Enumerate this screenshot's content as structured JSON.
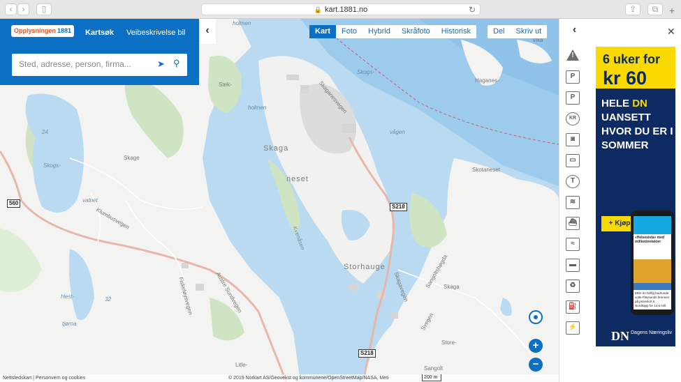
{
  "browser": {
    "url": "kart.1881.no",
    "back_icon": "chevron-left-icon",
    "forward_icon": "chevron-right-icon"
  },
  "header": {
    "logo_text": "Opplysningen",
    "logo_number": "1881",
    "tabs": [
      "Kartsøk",
      "Veibeskrivelse bil"
    ],
    "search_placeholder": "Sted, adresse, person, firma..."
  },
  "map_types": [
    "Kart",
    "Foto",
    "Hybrid",
    "Skråfoto",
    "Historisk"
  ],
  "map_actions": [
    "Del",
    "Skriv ut"
  ],
  "map_labels": {
    "water": [
      "Skogs-",
      "vågen",
      "Skogs-",
      "vatnet",
      "Hest-",
      "tjørna",
      "32",
      "24"
    ],
    "places": [
      "holmen",
      "Stek-",
      "holmen",
      "Skaga",
      "neset",
      "Storhauge",
      "Skotaneset",
      "Skaga",
      "Store-",
      "Sangolt",
      "Litle-",
      "Haganes-",
      "Vika",
      "Kvenåsen",
      "Skage"
    ],
    "roads": [
      "Skaganesvegen",
      "Austre Sundvegen",
      "Fiskeløysvegen",
      "Klumbusvegen",
      "Sangoltshøgda",
      "Skagavegen",
      "Svegen"
    ],
    "shields": [
      "560",
      "S218",
      "S218",
      "S218",
      "560"
    ]
  },
  "footer": {
    "left": "Nettstedskart | Personvern og cookies",
    "attribution": "© 2019 Norkart AS/Geovekst og kommunene/OpenStreetMap/NASA, Meti",
    "scale": "200 m"
  },
  "right_panel": {
    "icons": [
      "warning-icon",
      "parking-icon",
      "parking-garage-icon",
      "toll-icon",
      "camera-icon",
      "bus-icon",
      "tunnel-icon",
      "ferry-icon",
      "boat-icon",
      "fast-boat-icon",
      "card-icon",
      "recycling-icon",
      "fuel-icon",
      "charging-icon"
    ],
    "glyphs": [
      "!",
      "P",
      "P",
      "KR",
      "◙",
      "▭",
      "T",
      "≋",
      "⛴",
      "≈",
      "▬",
      "♻",
      "⛽",
      "⚡"
    ]
  },
  "ad": {
    "line1": "6 uker for",
    "line2": "kr 60",
    "body_a": "HELE ",
    "body_hl": "DN",
    "body_b": " UANSETT HVOR DU ER I SOMMER",
    "buy": "+ Kjøp",
    "phone_head": "«Helsesista» med millioninntekter",
    "phone_sub": "Etter en heftig budrunde solte Fløysunds brennes på priseslort 6. Nordkapp for 14,6 mill.",
    "brand": "DN",
    "brand_sub": "Dagens Næringsliv"
  },
  "colors": {
    "brand_blue": "#0b6fc4",
    "water": "#b9daf0",
    "ad_yellow": "#fad900",
    "ad_navy": "#0d2a63"
  }
}
